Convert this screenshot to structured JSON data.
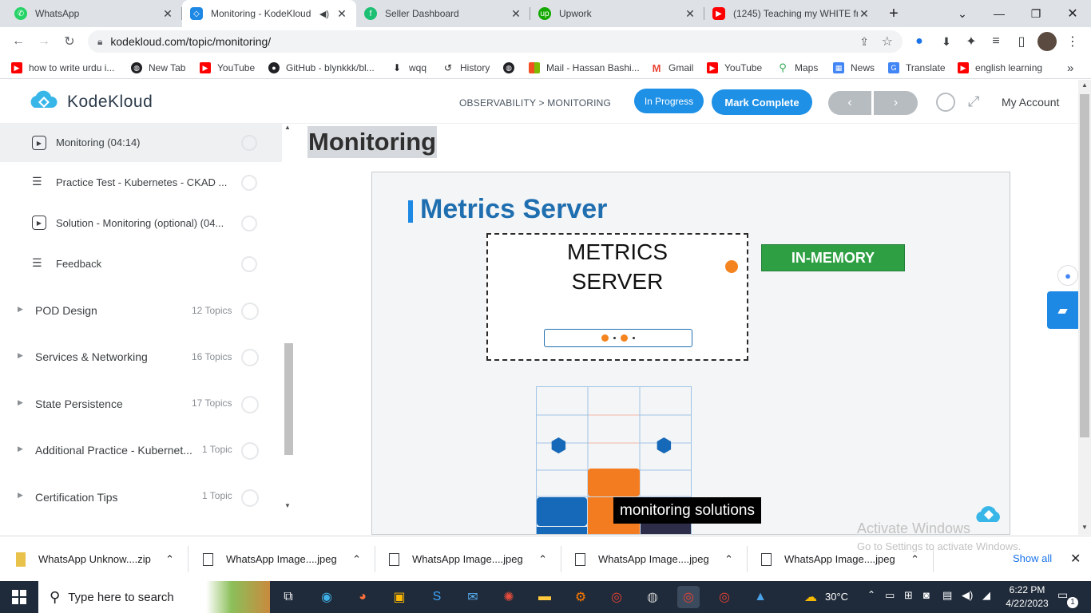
{
  "browser": {
    "tabs": [
      {
        "title": "WhatsApp",
        "icon": "whatsapp-icon",
        "color": "#25d366"
      },
      {
        "title": "Monitoring - KodeKloud",
        "icon": "kodekloud-icon",
        "color": "#1e88e5",
        "active": true
      },
      {
        "title": "Seller Dashboard",
        "icon": "fiverr-icon",
        "color": "#1dbf73"
      },
      {
        "title": "Upwork",
        "icon": "upwork-icon",
        "color": "#14a800"
      },
      {
        "title": "(1245) Teaching my WHITE fr",
        "icon": "youtube-icon",
        "color": "#ff0000"
      }
    ],
    "url": "kodekloud.com/topic/monitoring/",
    "bookmarks": [
      {
        "label": "how to write urdu i...",
        "icon": "youtube-icon",
        "color": "#ff0000"
      },
      {
        "label": "New Tab",
        "icon": "globe-icon",
        "color": "#202124"
      },
      {
        "label": "YouTube",
        "icon": "youtube-icon",
        "color": "#ff0000"
      },
      {
        "label": "GitHub - blynkkk/bl...",
        "icon": "github-icon",
        "color": "#202124"
      },
      {
        "label": "wqq",
        "icon": "download-icon",
        "color": "#202124"
      },
      {
        "label": "History",
        "icon": "history-icon",
        "color": "#202124"
      },
      {
        "label": "",
        "icon": "globe-icon",
        "color": "#202124"
      },
      {
        "label": "Mail - Hassan Bashi...",
        "icon": "microsoft-icon",
        "color": "#f25022"
      },
      {
        "label": "Gmail",
        "icon": "gmail-icon",
        "color": "#ea4335"
      },
      {
        "label": "YouTube",
        "icon": "youtube-icon",
        "color": "#ff0000"
      },
      {
        "label": "Maps",
        "icon": "maps-icon",
        "color": "#34a853"
      },
      {
        "label": "News",
        "icon": "news-icon",
        "color": "#4285f4"
      },
      {
        "label": "Translate",
        "icon": "translate-icon",
        "color": "#4285f4"
      },
      {
        "label": "english learning",
        "icon": "youtube-icon",
        "color": "#ff0000"
      }
    ],
    "more_bookmarks": "»"
  },
  "site": {
    "logo": "KodeKloud",
    "breadcrumb": "OBSERVABILITY > MONITORING",
    "status_button": "In Progress",
    "complete_button": "Mark Complete",
    "account": "My Account",
    "accent": "#1e90e6"
  },
  "sidebar": {
    "lessons": [
      {
        "label": "Monitoring (04:14)",
        "icon": "play-icon",
        "active": true
      },
      {
        "label": "Practice Test - Kubernetes - CKAD ...",
        "icon": "list-icon"
      },
      {
        "label": "Solution - Monitoring (optional) (04...",
        "icon": "play-icon"
      },
      {
        "label": "Feedback",
        "icon": "list-icon"
      }
    ],
    "sections": [
      {
        "label": "POD Design",
        "count": "12 Topics"
      },
      {
        "label": "Services & Networking",
        "count": "16 Topics"
      },
      {
        "label": "State Persistence",
        "count": "17 Topics"
      },
      {
        "label": "Additional Practice - Kubernet...",
        "count": "1 Topic"
      },
      {
        "label": "Certification Tips",
        "count": "1 Topic"
      }
    ]
  },
  "lesson": {
    "title": "Monitoring",
    "slide_title": "Metrics Server",
    "box_label_1": "METRICS",
    "box_label_2": "SERVER",
    "badge": "IN-MEMORY",
    "caption": "monitoring solutions"
  },
  "watermark": {
    "line1": "Activate Windows",
    "line2": "Go to Settings to activate Windows."
  },
  "downloads": {
    "items": [
      "WhatsApp Unknow....zip",
      "WhatsApp Image....jpeg",
      "WhatsApp Image....jpeg",
      "WhatsApp Image....jpeg",
      "WhatsApp Image....jpeg"
    ],
    "show_all": "Show all"
  },
  "taskbar": {
    "search_placeholder": "Type here to search",
    "weather": "30°C",
    "time": "6:22 PM",
    "date": "4/22/2023",
    "notifications": "1"
  }
}
